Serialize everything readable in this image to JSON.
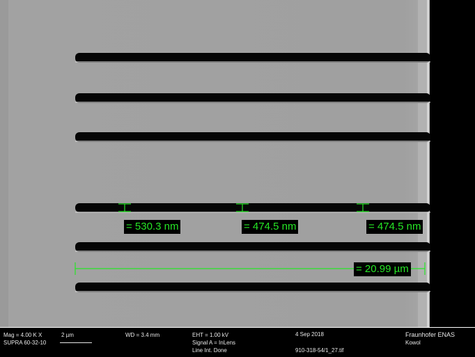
{
  "measurements": {
    "m1": "= 530.3 nm",
    "m2": "= 474.5 nm",
    "m3": "= 474.5 nm",
    "m4": "= 20.99 µm"
  },
  "infobar": {
    "mag": "Mag =   4.00 K X",
    "scale": "2 µm",
    "instrument": "SUPRA 60-32-10",
    "wd": "WD =   3.4 mm",
    "eht": "EHT =   1.00 kV",
    "signal": "Signal A = InLens",
    "line_int": "Line Int. Done",
    "date": "4 Sep 2018",
    "filename": "910-318-54/1_27.tif",
    "org": "Fraunhofer ENAS",
    "operator": "Kowol"
  },
  "colors": {
    "measure": "#26e626",
    "substrate": "#9f9f9f",
    "trench": "#050505",
    "background": "#000000"
  }
}
